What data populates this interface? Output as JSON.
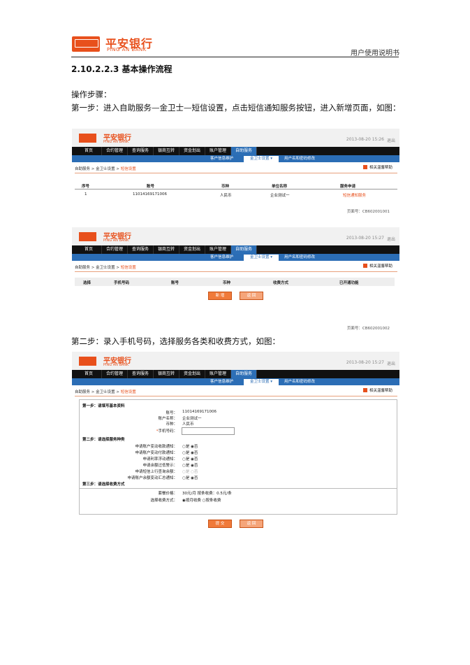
{
  "page_header": {
    "logo_seal_text": "中国平安",
    "logo_cn": "平安银行",
    "logo_en": "PING AN BANK",
    "manual_title": "用户使用说明书"
  },
  "section_title": "2.10.2.2.3 基本操作流程",
  "paragraphs": {
    "steps_label": "操作步骤：",
    "step1": "第一步：进入自助服务—金卫士—短信设置，点击短信通知服务按钮，进入新增页面，如图：",
    "step2": "第二步：录入手机号码，选择服务各类和收费方式，如图："
  },
  "app": {
    "bank_cn": "平安银行",
    "bank_en": "PING AN BANK",
    "exit": "退出",
    "nav": [
      "首页",
      "合约管理",
      "查询服务",
      "银商互转",
      "资金划出",
      "账户管理",
      "自助服务"
    ],
    "subnav": [
      "客户信息维护",
      "金卫士设置 ▾",
      "用户名和密码修改"
    ],
    "help": "相关温馨帮助"
  },
  "shot1": {
    "datetime": "2013-08-20  15:26",
    "breadcrumb": [
      "自助服务",
      "金卫士设置",
      "短信设置"
    ],
    "headers": [
      "序号",
      "账号",
      "币种",
      "单位名称",
      "服务申请"
    ],
    "rows": [
      [
        "1",
        "11014169171006",
        "人民币",
        "企业测试一",
        "短信通知服务"
      ]
    ],
    "page_no": "页面号：CB602001001"
  },
  "shot2": {
    "datetime": "2013-08-20  15:27",
    "breadcrumb": [
      "自助服务",
      "金卫士设置",
      "短信设置"
    ],
    "headers": [
      "选择",
      "手机号码",
      "账号",
      "币种",
      "收费方式",
      "已开通功能"
    ],
    "btn_add": "新 增",
    "btn_back": "返 回",
    "page_no": "页面号：CB602001002"
  },
  "shot3": {
    "datetime": "2013-08-20  15:27",
    "breadcrumb": [
      "自助服务",
      "金卫士设置",
      "短信设置"
    ],
    "sec1": "第一步：请填写基本资料",
    "f_account_label": "账号：",
    "f_account": "11014169171006",
    "f_name_label": "账户名称：",
    "f_name": "企业测试一",
    "f_cur_label": "币种：",
    "f_cur": "人民币",
    "f_phone_label": "手机号码：",
    "sec2": "第二步：请选择服务种类",
    "services": [
      "申请账户变动收款通知：",
      "申请账户变动付款通知：",
      "申请利率浮动通知：",
      "申请余额过低警示：",
      "申请短信上行查询余额：",
      "申请账户余额变动汇总通知："
    ],
    "yes": "是",
    "no": "否",
    "sec3": "第三步：请选择收费方式",
    "price_label": "套餐价格：",
    "price": "30元/月  按条收费：0.5元/条",
    "charge_label": "选择收费方式：",
    "charge_opt1": "按月收费",
    "charge_opt2": "按条收费",
    "btn_submit": "提 交",
    "btn_back": "返 回"
  }
}
